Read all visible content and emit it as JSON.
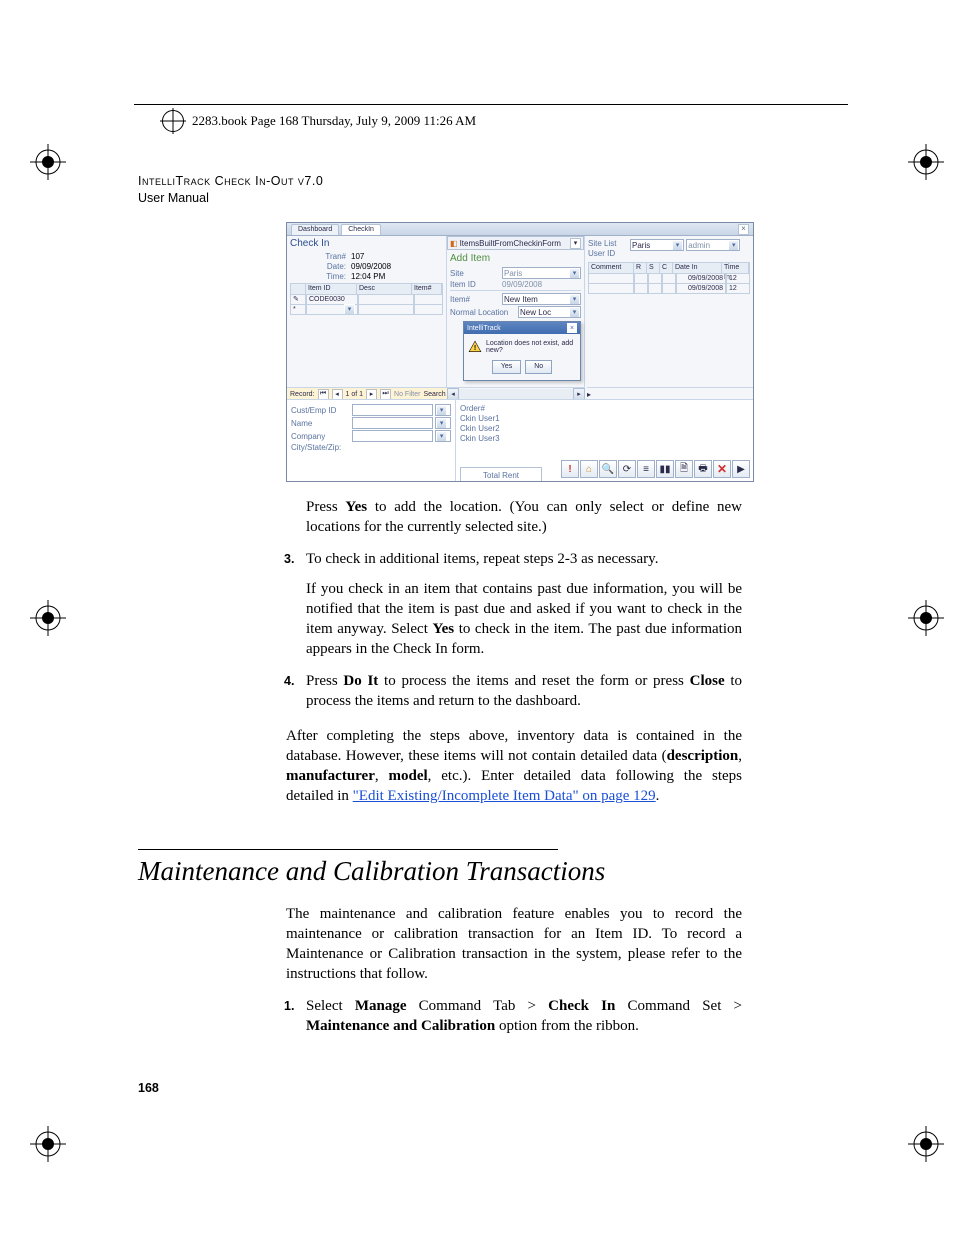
{
  "topline": "2283.book  Page 168  Thursday, July 9, 2009  11:26 AM",
  "running_head": {
    "line1": "IntelliTrack Check In-Out v7.0",
    "line2": "User Manual"
  },
  "figure": {
    "tabs": {
      "dashboard": "Dashboard",
      "checkin": "CheckIn"
    },
    "checkin": {
      "title": "Check In",
      "trans_label": "Tran#",
      "trans_value": "107",
      "date_label": "Date:",
      "date_value": "09/09/2008",
      "time_label": "Time:",
      "time_value": "12:04 PM",
      "cols": {
        "itemid": "Item ID",
        "desc": "Desc",
        "itemnum": "Item#"
      },
      "row_itemid": "CODE0030",
      "record_bar": {
        "label": "Record:",
        "pos": "1 of 1",
        "filter": "No Filter",
        "search": "Search"
      }
    },
    "additem": {
      "panel": "ItemsBuiltFromCheckinForm",
      "title": "Add Item",
      "site_label": "Site",
      "site_value": "Paris",
      "itemid_label": "Item ID",
      "itemid_value": "09/09/2008",
      "itemnum_label": "Item#",
      "itemnum_value": "New Item",
      "loc_label": "Normal Location",
      "loc_value": "New Loc"
    },
    "right": {
      "sitelist_label": "Site List",
      "sitelist_value": "Paris",
      "userid_label": "User ID",
      "userid_value": "admin",
      "cols": {
        "comment": "Comment",
        "r": "R",
        "s": "S",
        "c": "C",
        "datein": "Date In",
        "timein": "Time In"
      },
      "row_date1": "09/09/2008",
      "row_date2": "09/09/2008"
    },
    "modal": {
      "title": "IntelliTrack",
      "msg": "Location does not exist, add new?",
      "yes": "Yes",
      "no": "No"
    },
    "lower": {
      "cust_label": "Cust/Emp ID",
      "name_label": "Name",
      "company_label": "Company",
      "csz_label": "City/State/Zip:",
      "order_label": "Order#",
      "ck1": "Ckin User1",
      "ck2": "Ckin User2",
      "ck3": "Ckin User3",
      "total": "Total Rent"
    },
    "toolbar_icons": [
      "!",
      "⌂",
      "🔍",
      "⟳",
      "≡",
      "▮▮",
      "🗎",
      "🖶",
      "✕",
      "▶"
    ]
  },
  "para1a": "Press ",
  "para1b": "Yes",
  "para1c": " to add the location. (You can only select or define new locations for the currently selected site.)",
  "step3": {
    "num": "3.",
    "line1": "To check in additional items, repeat steps 2-3 as necessary.",
    "p2a": "If you check in an item that contains past due information, you will be notified that the item is past due and asked if you want to check in the item anyway. Select ",
    "p2b": "Yes",
    "p2c": " to check in the item. The past due information appears in the Check In form."
  },
  "step4": {
    "num": "4.",
    "a": "Press ",
    "b": "Do It",
    "c": " to process the items and reset the form or press ",
    "d": "Close",
    "e": " to process the items and return to the dashboard."
  },
  "after": {
    "a": "After completing the steps above, inventory data is contained in the database. However, these items will not contain detailed data (",
    "b": "description",
    "c": ", ",
    "d": "manufacturer",
    "e": ", ",
    "f": "model",
    "g": ", etc.). Enter detailed data following the steps detailed in ",
    "link": "\"Edit Existing/Incomplete Item Data\" on page 129",
    "h": "."
  },
  "section_heading": "Maintenance and Calibration Transactions",
  "maint_para": "The maintenance and calibration feature enables you to record the maintenance or calibration transaction for an Item ID. To record a Maintenance or Calibration transaction in the system, please refer to the instructions that follow.",
  "step1": {
    "num": "1.",
    "a": "Select ",
    "b": "Manage",
    "c": " Command Tab > ",
    "d": "Check In",
    "e": " Command Set > ",
    "f": "Maintenance and Calibration",
    "g": " option from the ribbon."
  },
  "page_number": "168"
}
